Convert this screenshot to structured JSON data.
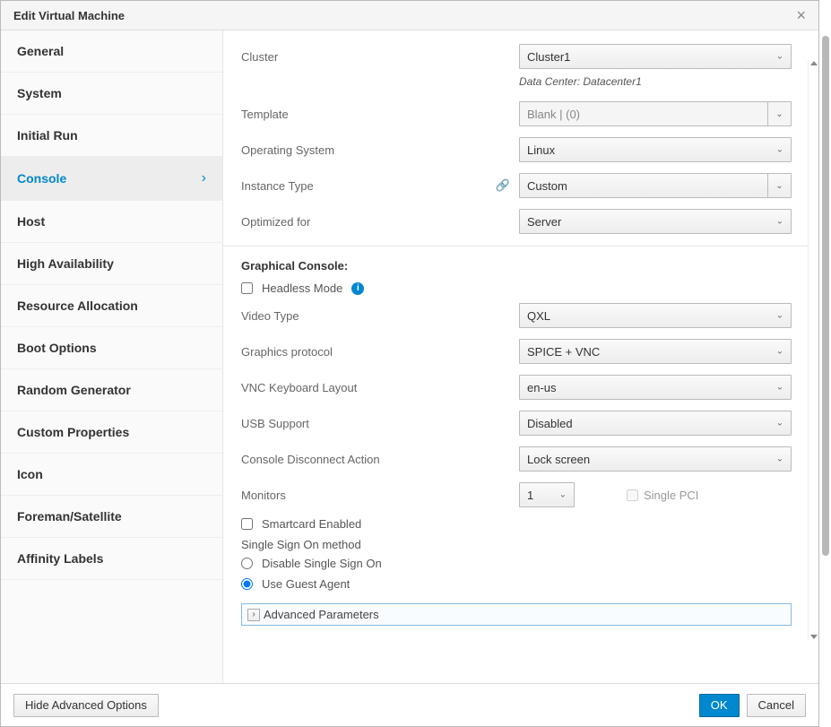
{
  "modal": {
    "title": "Edit Virtual Machine"
  },
  "sidebar": {
    "items": [
      {
        "label": "General"
      },
      {
        "label": "System"
      },
      {
        "label": "Initial Run"
      },
      {
        "label": "Console"
      },
      {
        "label": "Host"
      },
      {
        "label": "High Availability"
      },
      {
        "label": "Resource Allocation"
      },
      {
        "label": "Boot Options"
      },
      {
        "label": "Random Generator"
      },
      {
        "label": "Custom Properties"
      },
      {
        "label": "Icon"
      },
      {
        "label": "Foreman/Satellite"
      },
      {
        "label": "Affinity Labels"
      }
    ],
    "active_index": 3
  },
  "general": {
    "cluster_label": "Cluster",
    "cluster_value": "Cluster1",
    "datacenter_text": "Data Center: Datacenter1",
    "template_label": "Template",
    "template_value": "Blank |  (0)",
    "os_label": "Operating System",
    "os_value": "Linux",
    "instance_type_label": "Instance Type",
    "instance_type_value": "Custom",
    "optimized_label": "Optimized for",
    "optimized_value": "Server"
  },
  "console": {
    "section_title": "Graphical Console:",
    "headless_label": "Headless Mode",
    "headless_checked": false,
    "video_type_label": "Video Type",
    "video_type_value": "QXL",
    "graphics_protocol_label": "Graphics protocol",
    "graphics_protocol_value": "SPICE + VNC",
    "vnc_layout_label": "VNC Keyboard Layout",
    "vnc_layout_value": "en-us",
    "usb_label": "USB Support",
    "usb_value": "Disabled",
    "disconnect_label": "Console Disconnect Action",
    "disconnect_value": "Lock screen",
    "monitors_label": "Monitors",
    "monitors_value": "1",
    "single_pci_label": "Single PCI",
    "single_pci_checked": false,
    "smartcard_label": "Smartcard Enabled",
    "smartcard_checked": false,
    "sso_title": "Single Sign On method",
    "sso_disable_label": "Disable Single Sign On",
    "sso_guest_label": "Use Guest Agent",
    "sso_selected": "guest",
    "advanced_params_label": "Advanced Parameters"
  },
  "footer": {
    "hide_advanced": "Hide Advanced Options",
    "ok": "OK",
    "cancel": "Cancel"
  }
}
